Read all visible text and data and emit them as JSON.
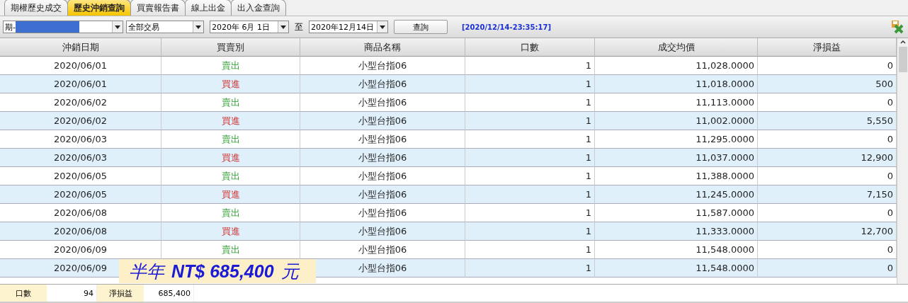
{
  "tabs": [
    {
      "label": "期權歷史成交",
      "selected": false
    },
    {
      "label": "歷史沖銷查詢",
      "selected": true
    },
    {
      "label": "買賣報告書",
      "selected": false
    },
    {
      "label": "線上出金",
      "selected": false
    },
    {
      "label": "出入金查詢",
      "selected": false
    }
  ],
  "toolbar": {
    "account": "期-",
    "trade_type": "全部交易",
    "date_from": "2020年 6月 1日",
    "to_label": "至",
    "date_to": "2020年12月14日",
    "query_button": "查詢",
    "timestamp": "[2020/12/14-23:35:17]"
  },
  "table": {
    "columns": [
      "沖銷日期",
      "買賣別",
      "商品名稱",
      "口數",
      "成交均價",
      "淨損益"
    ],
    "rows": [
      {
        "date": "2020/06/01",
        "side": "賣出",
        "color": "#2e9e2e",
        "product": "小型台指06",
        "qty": "1",
        "price": "11,028.0000",
        "pnl": "0"
      },
      {
        "date": "2020/06/01",
        "side": "買進",
        "color": "#d23030",
        "product": "小型台指06",
        "qty": "1",
        "price": "11,018.0000",
        "pnl": "500"
      },
      {
        "date": "2020/06/02",
        "side": "賣出",
        "color": "#2e9e2e",
        "product": "小型台指06",
        "qty": "1",
        "price": "11,113.0000",
        "pnl": "0"
      },
      {
        "date": "2020/06/02",
        "side": "買進",
        "color": "#d23030",
        "product": "小型台指06",
        "qty": "1",
        "price": "11,002.0000",
        "pnl": "5,550"
      },
      {
        "date": "2020/06/03",
        "side": "賣出",
        "color": "#2e9e2e",
        "product": "小型台指06",
        "qty": "1",
        "price": "11,295.0000",
        "pnl": "0"
      },
      {
        "date": "2020/06/03",
        "side": "買進",
        "color": "#d23030",
        "product": "小型台指06",
        "qty": "1",
        "price": "11,037.0000",
        "pnl": "12,900"
      },
      {
        "date": "2020/06/05",
        "side": "賣出",
        "color": "#2e9e2e",
        "product": "小型台指06",
        "qty": "1",
        "price": "11,388.0000",
        "pnl": "0"
      },
      {
        "date": "2020/06/05",
        "side": "買進",
        "color": "#d23030",
        "product": "小型台指06",
        "qty": "1",
        "price": "11,245.0000",
        "pnl": "7,150"
      },
      {
        "date": "2020/06/08",
        "side": "賣出",
        "color": "#2e9e2e",
        "product": "小型台指06",
        "qty": "1",
        "price": "11,587.0000",
        "pnl": "0"
      },
      {
        "date": "2020/06/08",
        "side": "買進",
        "color": "#d23030",
        "product": "小型台指06",
        "qty": "1",
        "price": "11,333.0000",
        "pnl": "12,700"
      },
      {
        "date": "2020/06/09",
        "side": "賣出",
        "color": "#2e9e2e",
        "product": "小型台指06",
        "qty": "1",
        "price": "11,548.0000",
        "pnl": "0"
      },
      {
        "date": "2020/06/09",
        "product": "小型台指06",
        "qty": "1",
        "price": "11,548.0000",
        "pnl": "0"
      }
    ]
  },
  "summary": [
    {
      "label": "口數",
      "value": "94"
    },
    {
      "label": "淨損益",
      "value": "685,400"
    }
  ],
  "banner": "半年 **NT$ 685,400** 元"
}
